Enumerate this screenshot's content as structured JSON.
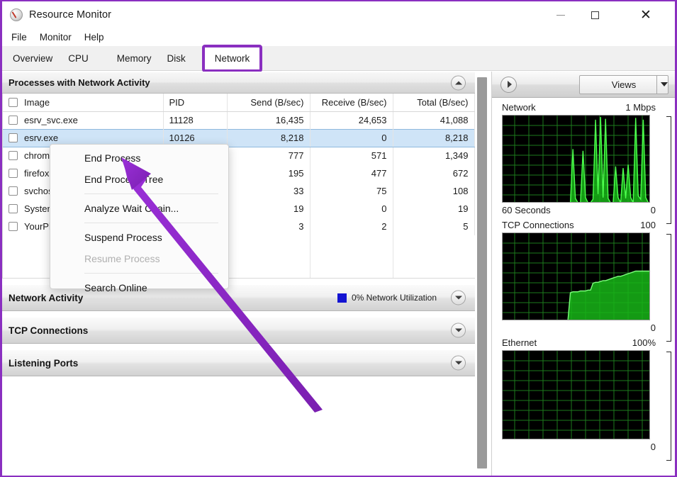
{
  "window": {
    "title": "Resource Monitor",
    "icon": "gauge-icon",
    "minimize_label": "—",
    "maximize_label": "□",
    "close_label": "✕"
  },
  "menubar": {
    "items": [
      {
        "label": "File"
      },
      {
        "label": "Monitor"
      },
      {
        "label": "Help"
      }
    ]
  },
  "tabs": [
    {
      "label": "Overview",
      "active": false
    },
    {
      "label": "CPU",
      "active": false
    },
    {
      "label": "Memory",
      "active": false
    },
    {
      "label": "Disk",
      "active": false
    },
    {
      "label": "Network",
      "active": true
    }
  ],
  "highlight_color": "#8a2fc0",
  "sections": {
    "processes": {
      "title": "Processes with Network Activity",
      "expanded": true,
      "caret": "chevron-up-icon",
      "columns": [
        "Image",
        "PID",
        "Send (B/sec)",
        "Receive (B/sec)",
        "Total (B/sec)"
      ],
      "rows": [
        {
          "image": "esrv_svc.exe",
          "pid": "11128",
          "send": "16,435",
          "receive": "24,653",
          "total": "41,088",
          "selected": false
        },
        {
          "image": "esrv.exe",
          "pid": "10126",
          "send": "8,218",
          "receive": "0",
          "total": "8,218",
          "selected": true
        },
        {
          "image": "chrome",
          "pid": "",
          "send": "777",
          "receive": "571",
          "total": "1,349",
          "selected": false
        },
        {
          "image": "firefox.",
          "pid": "",
          "send": "195",
          "receive": "477",
          "total": "672",
          "selected": false
        },
        {
          "image": "svchost",
          "pid": "",
          "send": "33",
          "receive": "75",
          "total": "108",
          "selected": false
        },
        {
          "image": "System",
          "pid": "",
          "send": "19",
          "receive": "0",
          "total": "19",
          "selected": false
        },
        {
          "image": "YourPh",
          "pid": "",
          "send": "3",
          "receive": "2",
          "total": "5",
          "selected": false
        }
      ]
    },
    "network_activity": {
      "title": "Network Activity",
      "utilization_text": "0% Network Utilization",
      "utilization_color": "#1414d2",
      "expanded": false,
      "caret": "chevron-down-icon"
    },
    "tcp_connections": {
      "title": "TCP Connections",
      "expanded": false,
      "caret": "chevron-down-icon"
    },
    "listening_ports": {
      "title": "Listening Ports",
      "expanded": false,
      "caret": "chevron-down-icon"
    }
  },
  "context_menu": {
    "items": [
      {
        "label": "End Process",
        "disabled": false,
        "separator_after": false
      },
      {
        "label": "End Process Tree",
        "disabled": false,
        "separator_after": true
      },
      {
        "label": "Analyze Wait Chain...",
        "disabled": false,
        "separator_after": true
      },
      {
        "label": "Suspend Process",
        "disabled": false,
        "separator_after": false
      },
      {
        "label": "Resume Process",
        "disabled": true,
        "separator_after": true
      },
      {
        "label": "Search Online",
        "disabled": false,
        "separator_after": false
      }
    ]
  },
  "right_panel": {
    "expand_button": "chevron-right-icon",
    "views_label": "Views",
    "views_dropdown": "chevron-down-icon"
  },
  "chart_data": [
    {
      "type": "area",
      "title": "Network",
      "ymax_label": "1 Mbps",
      "ymin_label": "0",
      "xlabel": "60 Seconds",
      "ylim": [
        0,
        1
      ],
      "xlim": [
        0,
        60
      ],
      "grid": true,
      "line_color": "#33ff33",
      "fill_color": "#13a813",
      "background": "#000000",
      "values": [
        0,
        0,
        0,
        0,
        0,
        0,
        0,
        0,
        0,
        0,
        0,
        0,
        0,
        0,
        0,
        0,
        0,
        0,
        0,
        0,
        0,
        0,
        0,
        0,
        0,
        0,
        0,
        0,
        0.62,
        0.05,
        0,
        0,
        0.6,
        0.06,
        0,
        0,
        0.04,
        0.96,
        0.1,
        0.99,
        0.06,
        0.97,
        0.05,
        0,
        0,
        0.42,
        0.06,
        0,
        0.4,
        0.05,
        0.44,
        0.06,
        0,
        0.98,
        0.08,
        0.04,
        0.96,
        0.06,
        0,
        0
      ]
    },
    {
      "type": "area",
      "title": "TCP Connections",
      "ymax_label": "100",
      "ymin_label": "0",
      "ylim": [
        0,
        100
      ],
      "xlim": [
        0,
        60
      ],
      "grid": true,
      "line_color": "#33ff33",
      "fill_color": "#13a813",
      "background": "#000000",
      "values": [
        0,
        0,
        0,
        0,
        0,
        0,
        0,
        0,
        0,
        0,
        0,
        0,
        0,
        0,
        0,
        0,
        0,
        0,
        0,
        0,
        0,
        0,
        0,
        0,
        0,
        0,
        0,
        32,
        33,
        33,
        33,
        34,
        34,
        34,
        35,
        35,
        43,
        44,
        44,
        45,
        46,
        46,
        47,
        48,
        49,
        50,
        51,
        51,
        52,
        53,
        54,
        55,
        56,
        57,
        57,
        57,
        57,
        57,
        57,
        57
      ]
    },
    {
      "type": "area",
      "title": "Ethernet",
      "ymax_label": "100%",
      "ymin_label": "0",
      "ylim": [
        0,
        100
      ],
      "xlim": [
        0,
        60
      ],
      "grid": true,
      "line_color": "#33ff33",
      "fill_color": "#13a813",
      "background": "#000000",
      "values": [
        0,
        0,
        0,
        0,
        0,
        0,
        0,
        0,
        0,
        0,
        0,
        0,
        0,
        0,
        0,
        0,
        0,
        0,
        0,
        0,
        0,
        0,
        0,
        0,
        0,
        0,
        0,
        0,
        0,
        0,
        0,
        0,
        0,
        0,
        0,
        0,
        0,
        0,
        0,
        0,
        0,
        0,
        0,
        0,
        0,
        0,
        0,
        0,
        0,
        0,
        0,
        0,
        0,
        0,
        0,
        0,
        0,
        0,
        0,
        0
      ]
    }
  ],
  "annotation": {
    "type": "arrow",
    "color": "#8a2fc0",
    "points_to": "End Process"
  }
}
